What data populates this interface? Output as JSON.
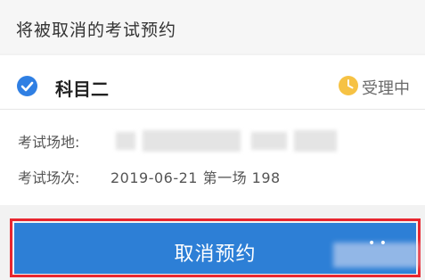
{
  "header": {
    "title": "将被取消的考试预约"
  },
  "appointment": {
    "subject": "科目二",
    "status": "受理中",
    "location_label": "考试场地:",
    "session_label": "考试场次:",
    "session_value": "2019-06-21 第一场 198"
  },
  "actions": {
    "cancel_label": "取消预约"
  },
  "colors": {
    "accent_blue": "#2d7fd6",
    "check_blue": "#2f7fe3",
    "status_yellow": "#f6c244",
    "highlight_red": "#e8262f"
  },
  "icons": {
    "check": "check-circle-icon",
    "status": "clock-icon"
  }
}
